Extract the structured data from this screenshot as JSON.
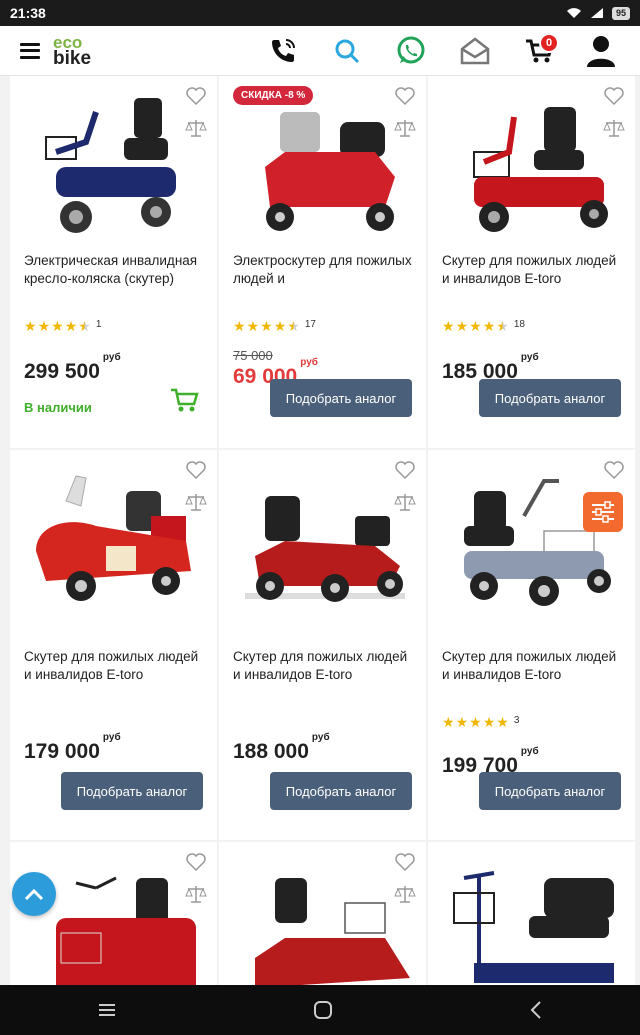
{
  "status": {
    "time": "21:38",
    "battery": "95"
  },
  "header": {
    "logo_top": "eco",
    "logo_bottom": "bike",
    "cart_count": "0"
  },
  "products": [
    {
      "title": "Электрическая инвалидная кресло-коляска (скутер)",
      "rating_count": "1",
      "price": "299 500",
      "currency": "руб",
      "stock": "В наличии",
      "stars": 4.5
    },
    {
      "title": "Электроскутер для пожилых людей и",
      "rating_count": "17",
      "old_price": "75 000",
      "price": "69 000",
      "currency": "руб",
      "sale": "СКИДКА -8 %",
      "button": "Подобрать аналог",
      "stars": 4.5
    },
    {
      "title": "Скутер для пожилых людей и инвалидов E-toro",
      "rating_count": "18",
      "price": "185 000",
      "currency": "руб",
      "button": "Подобрать аналог",
      "stars": 4.5
    },
    {
      "title": "Скутер для пожилых людей и инвалидов E-toro",
      "price": "179 000",
      "currency": "руб",
      "button": "Подобрать аналог"
    },
    {
      "title": "Скутер для пожилых людей и инвалидов E-toro",
      "price": "188 000",
      "currency": "руб",
      "button": "Подобрать аналог"
    },
    {
      "title": "Скутер для пожилых людей и инвалидов E-toro",
      "rating_count": "3",
      "price": "199 700",
      "currency": "руб",
      "button": "Подобрать аналог",
      "stars": 5
    }
  ]
}
